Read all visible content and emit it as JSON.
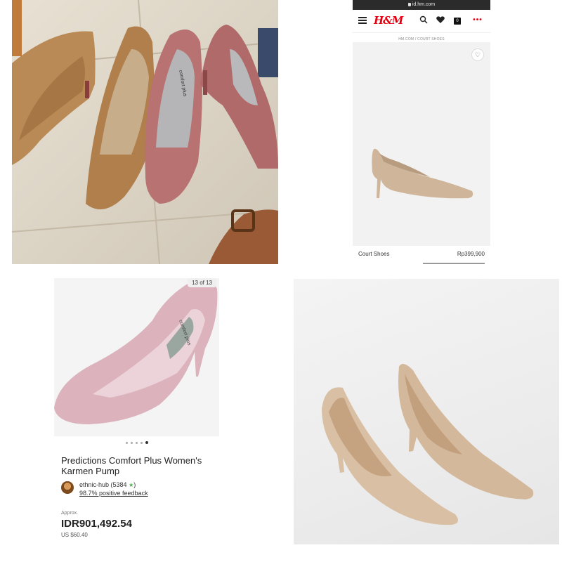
{
  "browser": {
    "url": "id.hm.com"
  },
  "hm": {
    "logo": "H&M",
    "breadcrumb": "HM.COM / COURT SHOES",
    "bag_count": "0",
    "more": "•••",
    "wish": "♡",
    "product": {
      "name": "Court Shoes",
      "price": "Rp399,900"
    }
  },
  "ebay": {
    "image_counter": "13 of 13",
    "title": "Predictions Comfort Plus Women's Karmen Pump",
    "seller": {
      "name": "ethnic-hub",
      "count_open": "(5384",
      "star": "★",
      "count_close": ")",
      "feedback": "98.7% positive feedback"
    },
    "approx_label": "Approx.",
    "price": "IDR901,492.54",
    "usd_price": "US $60.40"
  },
  "photo1": {
    "insole_brand": "comfort plus"
  },
  "colors": {
    "hm_red": "#e50010",
    "dark_tan": "#b07f4c",
    "rose": "#b87272",
    "beige": "#d4b89b",
    "pink": "#dcb3bd"
  }
}
